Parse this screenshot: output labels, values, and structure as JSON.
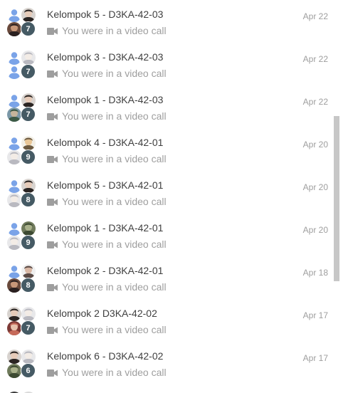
{
  "colors": {
    "default_avatar": "#7aa3e8",
    "count_badge": "#455a64",
    "scroll_thumb": "#c7c7c7"
  },
  "icons": {
    "call": "video-camera-icon",
    "avatar": "person-icon"
  },
  "scroll": {
    "thumb_position": 0.3,
    "thumb_fraction": 0.42
  },
  "conversations": [
    {
      "title": "Kelompok 5 - D3KA-42-03",
      "subtitle": "You were in a video call",
      "date": "Apr 22",
      "count": "7",
      "avatars": [
        "default",
        "photo-dark",
        "photo-mixed"
      ]
    },
    {
      "title": "Kelompok 3 - D3KA-42-03",
      "subtitle": "You were in a video call",
      "date": "Apr 22",
      "count": "7",
      "avatars": [
        "default",
        "photo-light",
        "default"
      ]
    },
    {
      "title": "Kelompok 1 - D3KA-42-03",
      "subtitle": "You were in a video call",
      "date": "Apr 22",
      "count": "7",
      "avatars": [
        "default",
        "photo-dark",
        "photo-outdoor"
      ]
    },
    {
      "title": "Kelompok 4 - D3KA-42-01",
      "subtitle": "You were in a video call",
      "date": "Apr 20",
      "count": "9",
      "avatars": [
        "default",
        "photo-cartoon",
        "photo-light"
      ]
    },
    {
      "title": "Kelompok 5 - D3KA-42-01",
      "subtitle": "You were in a video call",
      "date": "Apr 20",
      "count": "8",
      "avatars": [
        "default",
        "photo-dark",
        "photo-light"
      ]
    },
    {
      "title": "Kelompok 1 - D3KA-42-01",
      "subtitle": "You were in a video call",
      "date": "Apr 20",
      "count": "9",
      "avatars": [
        "default",
        "photo-green",
        "photo-light"
      ]
    },
    {
      "title": "Kelompok 2 - D3KA-42-01",
      "subtitle": "You were in a video call",
      "date": "Apr 18",
      "count": "8",
      "avatars": [
        "default",
        "photo-person",
        "photo-mixed"
      ]
    },
    {
      "title": "Kelompok 2 D3KA-42-02",
      "subtitle": "You were in a video call",
      "date": "Apr 17",
      "count": "7",
      "avatars": [
        "photo-dark",
        "photo-light",
        "photo-red"
      ]
    },
    {
      "title": "Kelompok 6 - D3KA-42-02",
      "subtitle": "You were in a video call",
      "date": "Apr 17",
      "count": "6",
      "avatars": [
        "photo-dark",
        "photo-light",
        "photo-green"
      ]
    }
  ]
}
